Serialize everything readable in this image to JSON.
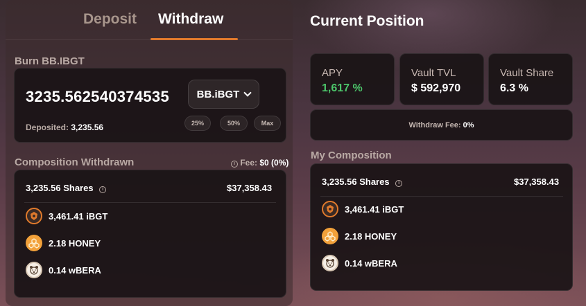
{
  "tabs": {
    "deposit": "Deposit",
    "withdraw": "Withdraw"
  },
  "burn": {
    "label": "Burn BB.IBGT",
    "amount": "3235.562540374535",
    "token": "BB.iBGT",
    "deposited_label": "Deposited:",
    "deposited_value": "3,235.56",
    "pct_buttons": [
      "25%",
      "50%",
      "Max"
    ]
  },
  "composition_withdrawn": {
    "label": "Composition Withdrawn",
    "fee_label": "Fee:",
    "fee_value": "$0 (0%)",
    "shares": "3,235.56 Shares",
    "usd": "$37,358.43",
    "tokens": [
      {
        "amount": "3,461.41 iBGT",
        "icon": "ibgt-icon"
      },
      {
        "amount": "2.18 HONEY",
        "icon": "honey-icon"
      },
      {
        "amount": "0.14 wBERA",
        "icon": "wbera-icon"
      }
    ]
  },
  "position": {
    "title": "Current Position",
    "apy_label": "APY",
    "apy_value": "1,617 %",
    "tvl_label": "Vault TVL",
    "tvl_value": "$ 592,970",
    "share_label": "Vault Share",
    "share_value": "6.3 %",
    "withdraw_fee_label": "Withdraw Fee:",
    "withdraw_fee_value": "0%"
  },
  "my_composition": {
    "label": "My Composition",
    "shares": "3,235.56 Shares",
    "usd": "$37,358.43",
    "tokens": [
      {
        "amount": "3,461.41 iBGT",
        "icon": "ibgt-icon"
      },
      {
        "amount": "2.18 HONEY",
        "icon": "honey-icon"
      },
      {
        "amount": "0.14 wBERA",
        "icon": "wbera-icon"
      }
    ]
  },
  "colors": {
    "accent": "#e07a2c",
    "positive": "#4cc56a"
  }
}
